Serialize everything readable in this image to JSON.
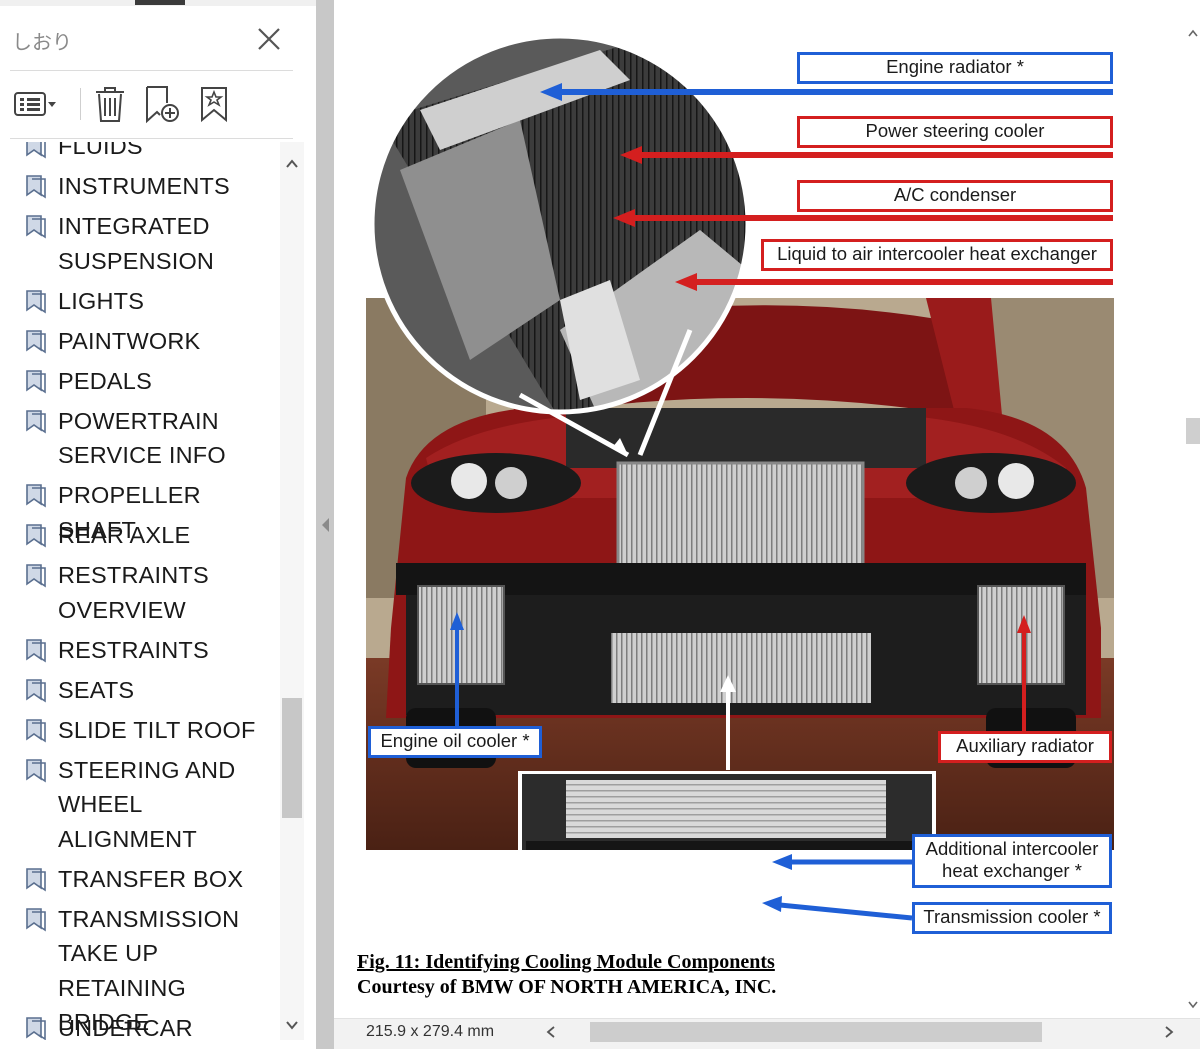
{
  "sidebar": {
    "title": "しおり",
    "close_icon": "close-icon",
    "toolbar": {
      "options_icon": "list-options-icon",
      "delete_icon": "trash-icon",
      "add_bookmark_icon": "add-bookmark-icon",
      "bookmark_tools_icon": "bookmark-gear-icon"
    },
    "items": [
      {
        "label": "FLUIDS"
      },
      {
        "label": "INSTRUMENTS"
      },
      {
        "label": "INTEGRATED\nSUSPENSION"
      },
      {
        "label": "LIGHTS"
      },
      {
        "label": "PAINTWORK"
      },
      {
        "label": "PEDALS"
      },
      {
        "label": "POWERTRAIN\nSERVICE INFO"
      },
      {
        "label": "PROPELLER SHAFT"
      },
      {
        "label": "REAR AXLE"
      },
      {
        "label": "RESTRAINTS\nOVERVIEW"
      },
      {
        "label": "RESTRAINTS"
      },
      {
        "label": "SEATS"
      },
      {
        "label": "SLIDE TILT ROOF"
      },
      {
        "label": "STEERING AND\nWHEEL\nALIGNMENT"
      },
      {
        "label": "TRANSFER BOX"
      },
      {
        "label": "TRANSMISSION\nTAKE UP\nRETAINING BRIDGE"
      },
      {
        "label": "UNDERCAR"
      }
    ]
  },
  "figure": {
    "callouts": {
      "engine_radiator": "Engine radiator *",
      "power_steering_cooler": "Power steering cooler",
      "ac_condenser": "A/C condenser",
      "liquid_intercooler": "Liquid to air intercooler heat exchanger",
      "engine_oil_cooler": "Engine oil cooler *",
      "auxiliary_radiator": "Auxiliary radiator",
      "additional_intercooler": "Additional intercooler\nheat exchanger *",
      "transmission_cooler": "Transmission cooler *"
    },
    "caption": "Fig. 11: Identifying Cooling Module Components",
    "credit": "Courtesy of BMW OF NORTH AMERICA, INC."
  },
  "statusbar": {
    "page_size": "215.9 x 279.4 mm"
  },
  "colors": {
    "callout_blue": "#1f5fd6",
    "callout_red": "#d41f1f",
    "car_red": "#8e1616"
  }
}
